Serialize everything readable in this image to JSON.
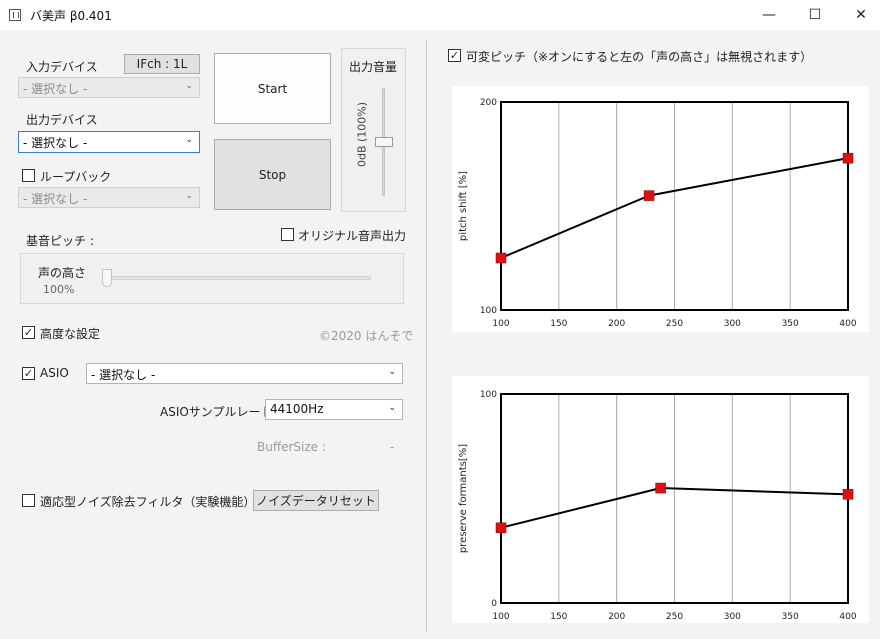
{
  "window": {
    "title": "バ美声 β0.401",
    "minimize": "—",
    "maximize": "☐",
    "close": "✕"
  },
  "left": {
    "input_device_label": "入力デバイス",
    "ifch_badge": "IFch : 1L",
    "input_device_value": "- 選択なし -",
    "output_device_label": "出力デバイス",
    "output_device_value": "- 選択なし -",
    "loopback_label": "ループバック",
    "loopback_value": "- 選択なし -",
    "start_label": "Start",
    "stop_label": "Stop",
    "output_volume_label": "出力音量",
    "output_volume_value": "0dB (100%)",
    "original_output_label": "オリジナル音声出力",
    "base_pitch_label": "基音ピッチ :",
    "voice_height_label": "声の高さ",
    "voice_height_value": "100%",
    "advanced_label": "高度な設定",
    "copyright": "©2020 はんそで",
    "asio_label": "ASIO",
    "asio_value": "- 選択なし -",
    "sample_rate_label": "ASIOサンプルレート :",
    "sample_rate_value": "44100Hz",
    "buffer_size_label": "BufferSize :",
    "buffer_size_value": "-",
    "noise_filter_label": "適応型ノイズ除去フィルタ（実験機能）",
    "noise_reset_label": "ノイズデータリセット"
  },
  "right": {
    "variable_pitch_label": "可変ピッチ（※オンにすると左の「声の高さ」は無視されます）"
  },
  "chart_data": [
    {
      "type": "line",
      "ylabel": "pitch shift [%]",
      "xlim": [
        100,
        400
      ],
      "ylim": [
        100,
        200
      ],
      "xticks": [
        100,
        150,
        200,
        250,
        300,
        350,
        400
      ],
      "yticks": [
        100,
        200
      ],
      "grid": "vertical",
      "x": [
        100,
        228,
        400
      ],
      "y": [
        125,
        155,
        173
      ],
      "line_color": "#000000",
      "marker_color": "#dd1111"
    },
    {
      "type": "line",
      "ylabel": "preserve formants[%]",
      "xlim": [
        100,
        400
      ],
      "ylim": [
        0,
        100
      ],
      "xticks": [
        100,
        150,
        200,
        250,
        300,
        350,
        400
      ],
      "yticks": [
        0,
        100
      ],
      "grid": "vertical",
      "x": [
        100,
        238,
        400
      ],
      "y": [
        36,
        55,
        52
      ],
      "line_color": "#000000",
      "marker_color": "#dd1111"
    }
  ]
}
